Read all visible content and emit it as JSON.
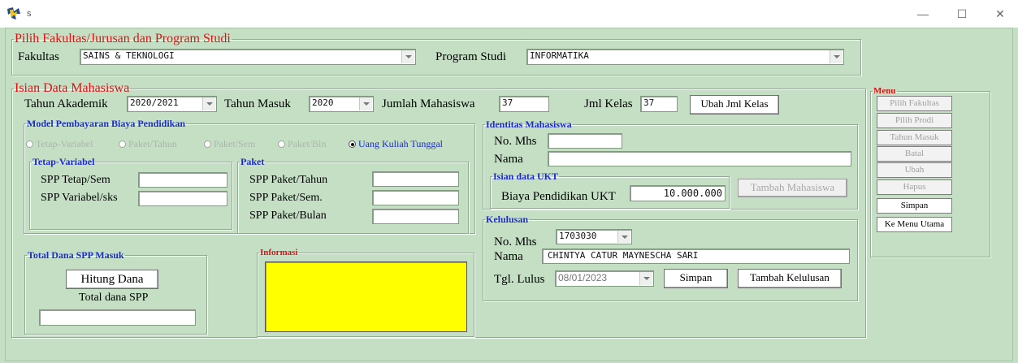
{
  "window": {
    "title": "s"
  },
  "fakultas_group": {
    "legend": "Pilih Fakultas/Jurusan  dan  Program Studi",
    "fakultas_label": "Fakultas",
    "fakultas_value": "SAINS & TEKNOLOGI",
    "prodi_label": "Program Studi",
    "prodi_value": "INFORMATIKA"
  },
  "isian": {
    "legend": "Isian Data  Mahasiswa",
    "tahun_akademik_label": "Tahun Akademik",
    "tahun_akademik_value": "2020/2021",
    "tahun_masuk_label": "Tahun Masuk",
    "tahun_masuk_value": "2020",
    "jumlah_mhs_label": "Jumlah Mahasiswa",
    "jumlah_mhs_value": "37",
    "jml_kelas_label": "Jml Kelas",
    "jml_kelas_value": "37",
    "ubah_jml_kelas_button": "Ubah Jml Kelas"
  },
  "model": {
    "legend": "Model Pembayaran Biaya Pendidikan",
    "options": [
      "Tetap-Variabel",
      "Paket/Tahun",
      "Paket/Sem",
      "Paket/Bln",
      "Uang Kuliah Tunggal"
    ],
    "selected": "Uang Kuliah Tunggal"
  },
  "tetap_variabel": {
    "legend": "Tetap-Variabel",
    "spp_tetap_label": "SPP Tetap/Sem",
    "spp_variabel_label": "SPP Variabel/sks"
  },
  "paket": {
    "legend": "Paket",
    "tahun_label": "SPP Paket/Tahun",
    "sem_label": "SPP Paket/Sem.",
    "bulan_label": "SPP Paket/Bulan"
  },
  "total": {
    "legend": "Total Dana SPP Masuk",
    "hitung_button": "Hitung Dana",
    "total_label": "Total dana SPP"
  },
  "informasi": {
    "legend": "Informasi"
  },
  "identitas": {
    "legend": "Identitas Mahasiswa",
    "nomhs_label": "No. Mhs",
    "nama_label": "Nama"
  },
  "ukt": {
    "legend": "Isian data UKT",
    "biaya_label": "Biaya Pendidikan UKT",
    "biaya_value": "10.000.000",
    "tambah_mhs_button": "Tambah Mahasiswa"
  },
  "kelulusan": {
    "legend": "Kelulusan",
    "nomhs_label": "No. Mhs",
    "nomhs_value": "1703030",
    "nama_label": "Nama",
    "nama_value": "CHINTYA CATUR MAYNESCHA SARI",
    "tgl_label": "Tgl. Lulus",
    "tgl_value": "08/01/2023",
    "simpan_button": "Simpan",
    "tambah_button": "Tambah Kelulusan"
  },
  "menu": {
    "legend": "Menu",
    "items": [
      {
        "label": "Pilih Fakultas",
        "enabled": false
      },
      {
        "label": "Pilih Prodi",
        "enabled": false
      },
      {
        "label": "Tahun Masuk",
        "enabled": false
      },
      {
        "label": "Batal",
        "enabled": false
      },
      {
        "label": "Ubah",
        "enabled": false
      },
      {
        "label": "Hapus",
        "enabled": false
      },
      {
        "label": "Simpan",
        "enabled": true
      },
      {
        "label": "Ke Menu Utama",
        "enabled": true
      }
    ]
  },
  "colors": {
    "background": "#c5dfc5",
    "legend_blue": "#1a2ad0",
    "legend_red": "#e01010",
    "info_box": "#ffff00"
  },
  "icons": {
    "app": "app-icon",
    "minimize": "minimize-icon",
    "maximize": "maximize-icon",
    "close": "close-icon"
  }
}
